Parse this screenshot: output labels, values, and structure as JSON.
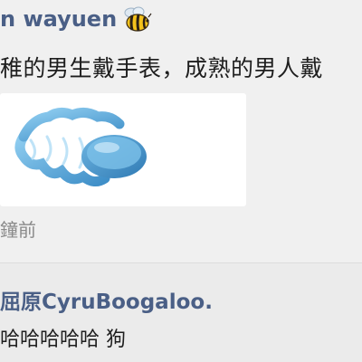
{
  "post": {
    "author": "n wayuen",
    "author_icon": "bee-emoji",
    "text": "稚的男生戴手表，成熟的男人戴",
    "image_subject": "blue-wristband-bracelet",
    "time": "鐘前"
  },
  "comment": {
    "author": "屈原CyruBoogaloo.",
    "text": "哈哈哈哈哈 狗"
  },
  "colors": {
    "author_name": "#4a5f86",
    "body_text": "#1e1e1e",
    "meta_text": "#8a8a8a",
    "background": "#ebebeb",
    "card": "#ffffff",
    "bracelet": "#5aa9dc"
  }
}
